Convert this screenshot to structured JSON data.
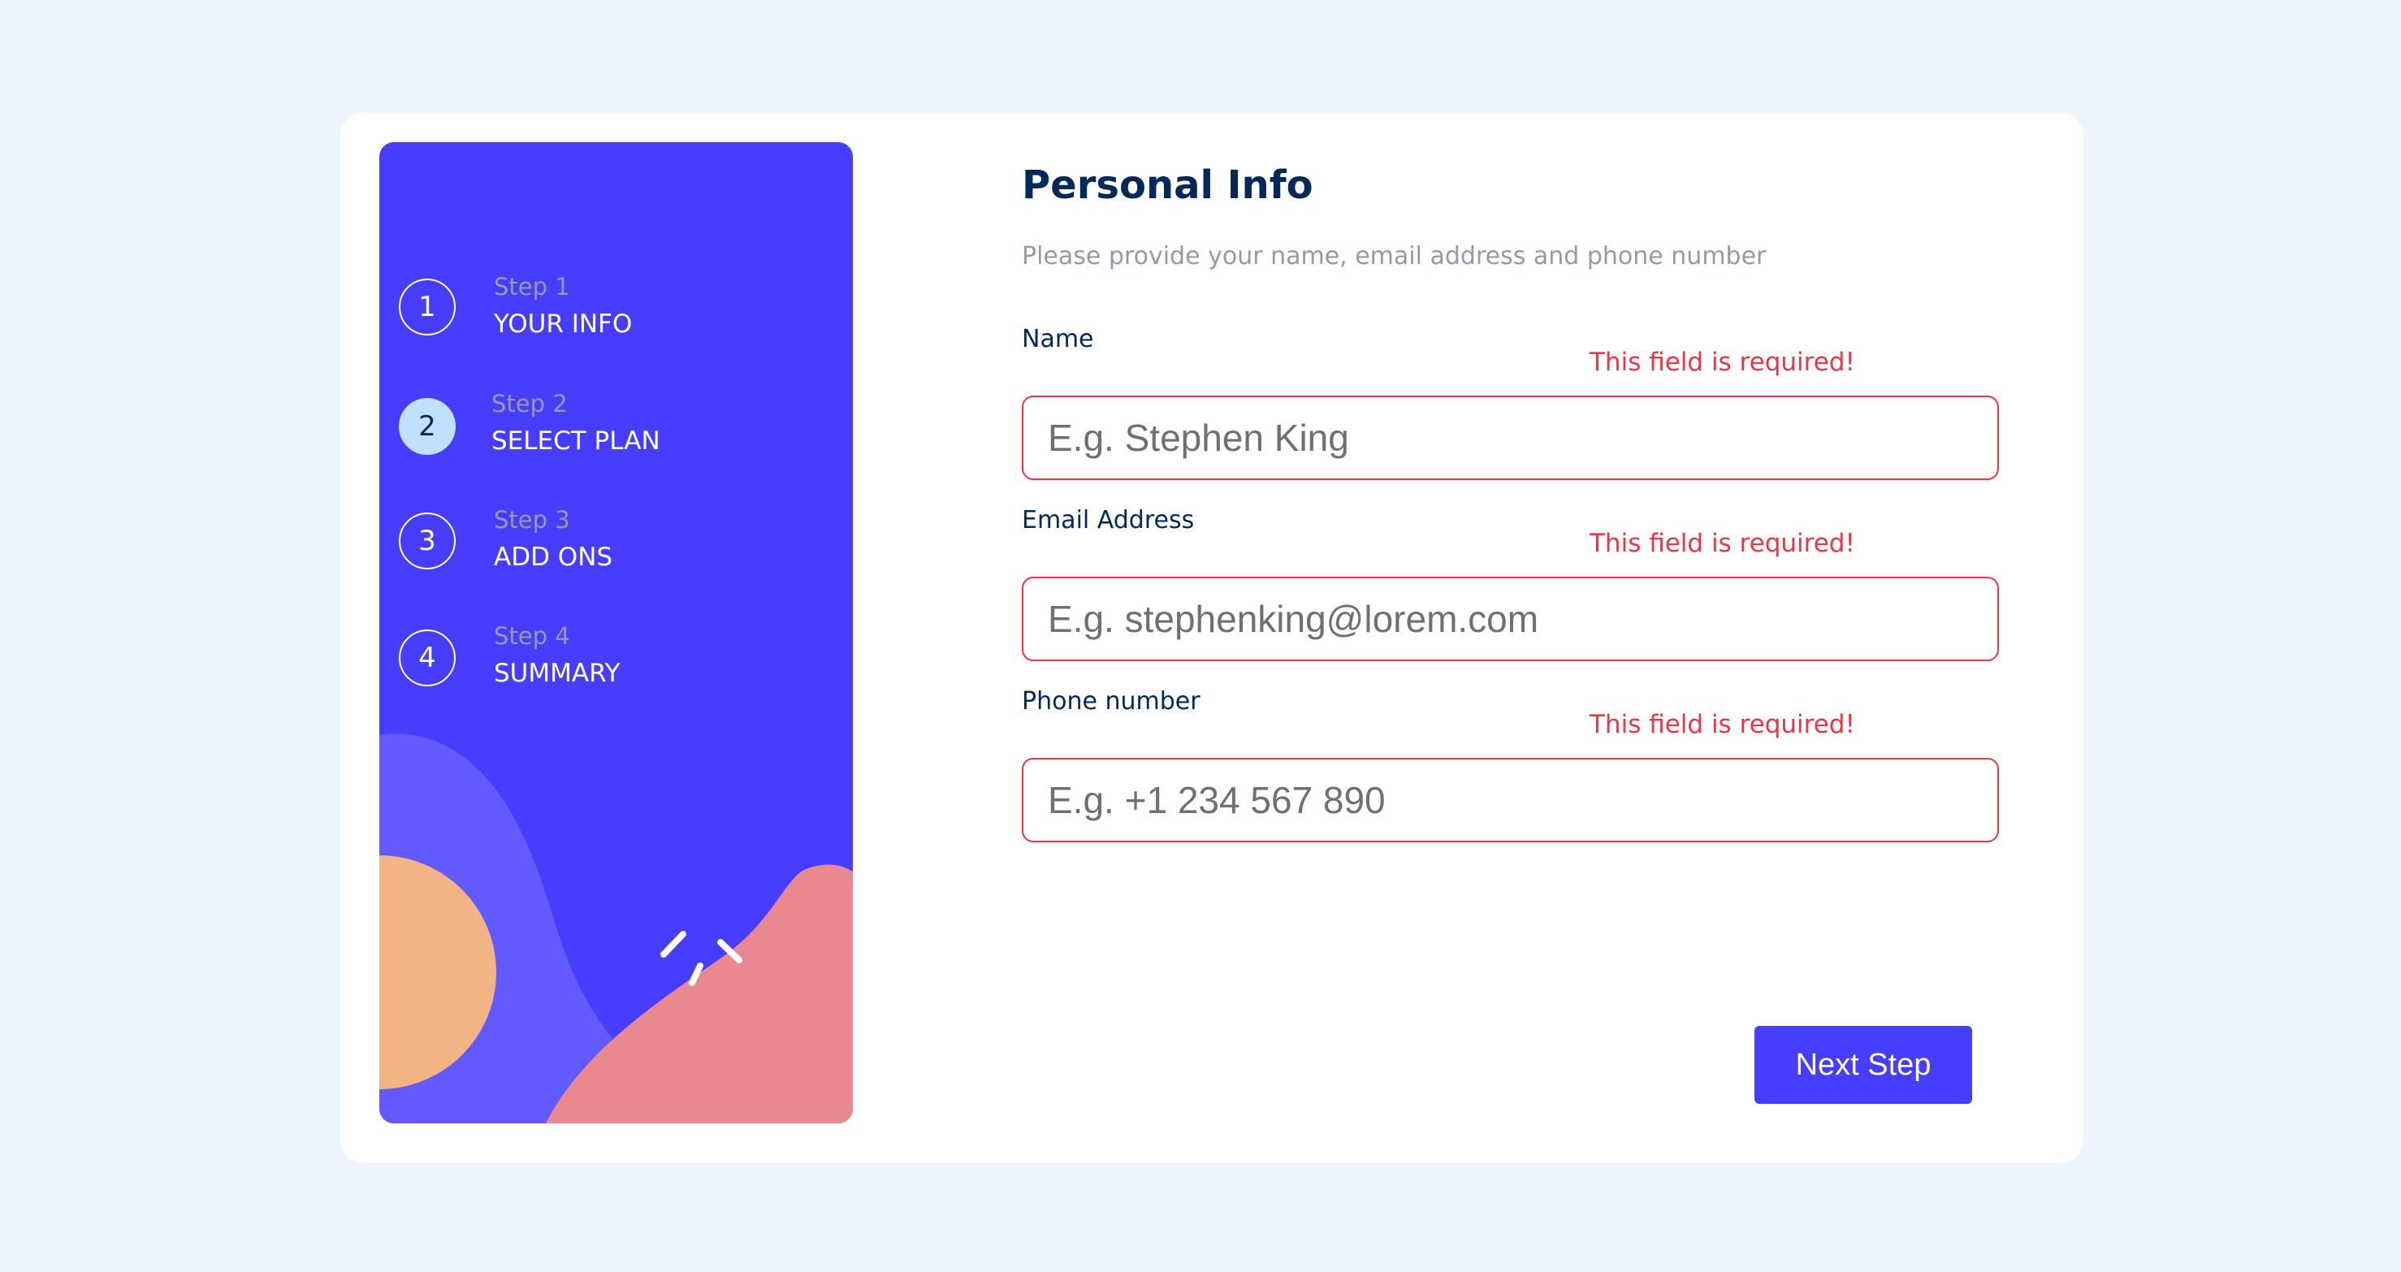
{
  "colors": {
    "page_background": "#eff5fe",
    "card_background": "#ffffff",
    "sidebar_background": "#473dff",
    "active_step": "#bee2fd",
    "title": "#02295a",
    "muted": "#9699ab",
    "error": "#ed3548",
    "button": "#473dff",
    "art_orange": "#f2b385",
    "art_pink": "#e9888f",
    "art_purple": "#6259ff"
  },
  "sidebar": {
    "steps": [
      {
        "number": "1",
        "sub": "Step 1",
        "name": "YOUR INFO",
        "active": false
      },
      {
        "number": "2",
        "sub": "Step 2",
        "name": "SELECT PLAN",
        "active": true
      },
      {
        "number": "3",
        "sub": "Step 3",
        "name": "ADD ONS",
        "active": false
      },
      {
        "number": "4",
        "sub": "Step 4",
        "name": "SUMMARY",
        "active": false
      }
    ]
  },
  "form": {
    "title": "Personal Info",
    "subtitle": "Please provide your name, email address and phone number",
    "fields": [
      {
        "label": "Name",
        "error": "This field is required!",
        "placeholder": "E.g. Stephen King",
        "value": ""
      },
      {
        "label": "Email Address",
        "error": "This field is required!",
        "placeholder": "E.g. stephenking@lorem.com",
        "value": ""
      },
      {
        "label": "Phone number",
        "error": "This field is required!",
        "placeholder": "E.g. +1 234 567 890",
        "value": ""
      }
    ],
    "next_button_label": "Next Step"
  }
}
